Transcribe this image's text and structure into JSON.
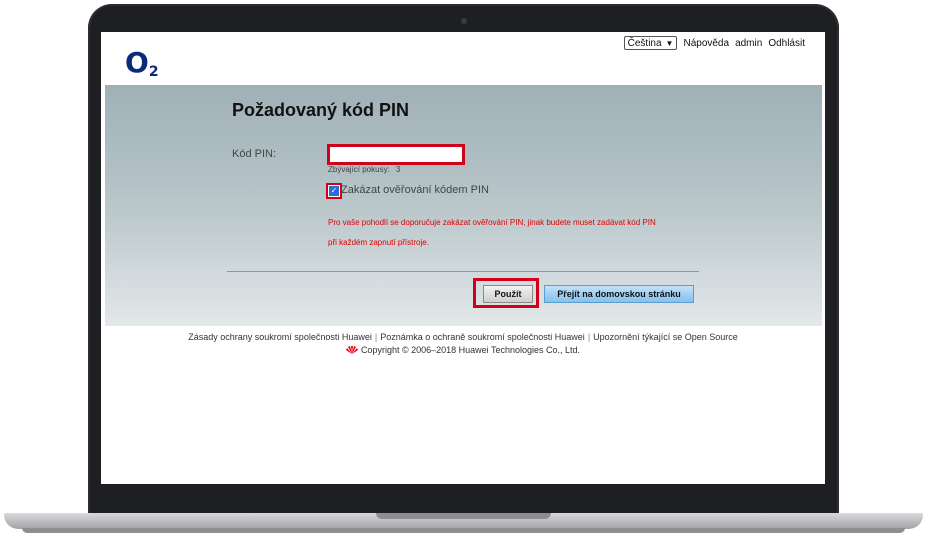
{
  "brand": {
    "logo_main": "O",
    "logo_sub": "2"
  },
  "topnav": {
    "language": "Čeština",
    "help": "Nápověda",
    "user": "admin",
    "logout": "Odhlásit"
  },
  "form": {
    "title": "Požadovaný kód PIN",
    "pin_label": "Kód PIN:",
    "pin_value": "",
    "attempts_label": "Zbývající pokusy:",
    "attempts_value": "3",
    "disable_pin_label": "Zakázat ověřování kódem PIN",
    "disable_pin_checked": true,
    "warning_line1": "Pro vaše pohodlí se doporučuje zakázat ověřování PIN, jinak budete muset zadávat kód PIN",
    "warning_line2": "při každém zapnutí přístroje.",
    "apply_button": "Použít",
    "home_button": "Přejít na domovskou stránku"
  },
  "footer": {
    "link1": "Zásady ochrany soukromí společnosti Huawei",
    "link2": "Poznámka o ochraně soukromí společnosti Huawei",
    "link3": "Upozornění týkající se Open Source",
    "copyright": "Copyright © 2006–2018 Huawei Technologies Co., Ltd."
  },
  "colors": {
    "highlight": "#d0021b",
    "warning_text": "#e00000",
    "panel_top": "#9fb0b6",
    "home_button": "#84c1ee",
    "logo": "#0a2a7a"
  },
  "icons": [
    "chevron-down-icon",
    "checkmark-icon",
    "huawei-logo-icon"
  ]
}
